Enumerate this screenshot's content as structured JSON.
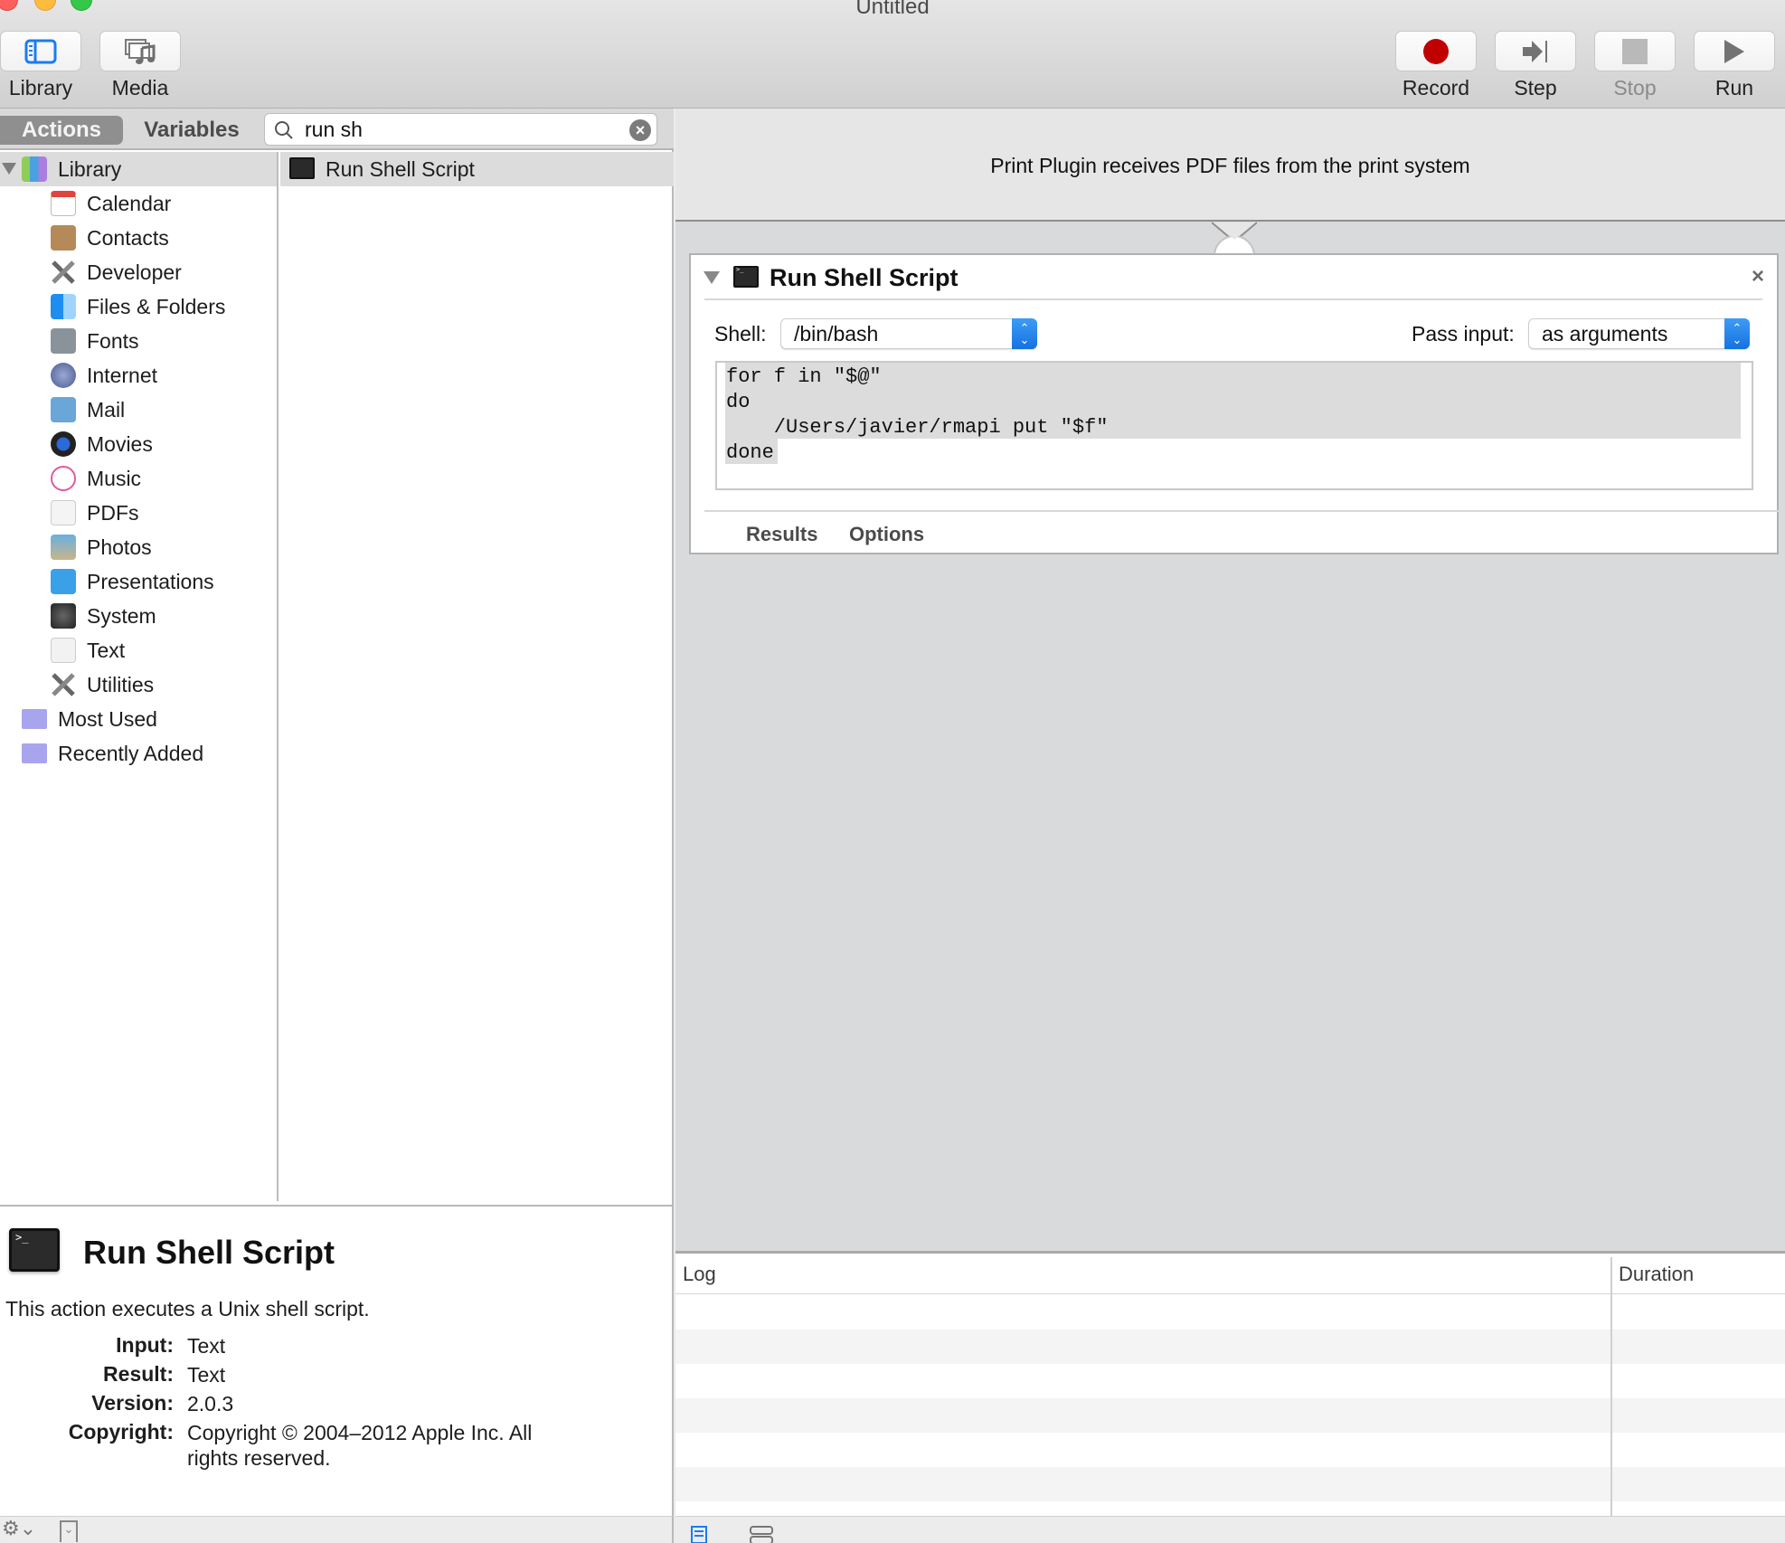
{
  "window": {
    "title": "Untitled"
  },
  "toolbar": {
    "left": [
      {
        "label": "Library",
        "icon": "library-sidebar-icon"
      },
      {
        "label": "Media",
        "icon": "media-icon"
      }
    ],
    "right": [
      {
        "label": "Record",
        "icon": "record-icon",
        "enabled": true
      },
      {
        "label": "Step",
        "icon": "step-icon",
        "enabled": true
      },
      {
        "label": "Stop",
        "icon": "stop-icon",
        "enabled": false
      },
      {
        "label": "Run",
        "icon": "run-icon",
        "enabled": true
      }
    ]
  },
  "left_panel": {
    "tabs": [
      {
        "label": "Actions",
        "active": true
      },
      {
        "label": "Variables",
        "active": false
      }
    ],
    "search": {
      "value": "run sh",
      "placeholder": ""
    },
    "library": {
      "root": "Library",
      "items": [
        "Calendar",
        "Contacts",
        "Developer",
        "Files & Folders",
        "Fonts",
        "Internet",
        "Mail",
        "Movies",
        "Music",
        "PDFs",
        "Photos",
        "Presentations",
        "System",
        "Text",
        "Utilities"
      ],
      "smart_groups": [
        "Most Used",
        "Recently Added"
      ]
    },
    "results": [
      "Run Shell Script"
    ],
    "description": {
      "title": "Run Shell Script",
      "summary": "This action executes a Unix shell script.",
      "meta": [
        {
          "key": "Input:",
          "value": "Text"
        },
        {
          "key": "Result:",
          "value": "Text"
        },
        {
          "key": "Version:",
          "value": "2.0.3"
        },
        {
          "key": "Copyright:",
          "value": "Copyright © 2004–2012 Apple Inc.  All rights reserved."
        }
      ]
    }
  },
  "workflow": {
    "input_description": "Print Plugin receives PDF files from the print system",
    "action": {
      "title": "Run Shell Script",
      "shell_label": "Shell:",
      "shell_value": "/bin/bash",
      "pass_input_label": "Pass input:",
      "pass_input_value": "as arguments",
      "script": "for f in \"$@\"\ndo\n    /Users/javier/rmapi put \"$f\"\ndone",
      "tabs": [
        "Results",
        "Options"
      ],
      "close_label": "×"
    }
  },
  "log": {
    "columns": [
      "Log",
      "Duration"
    ],
    "rows": []
  }
}
